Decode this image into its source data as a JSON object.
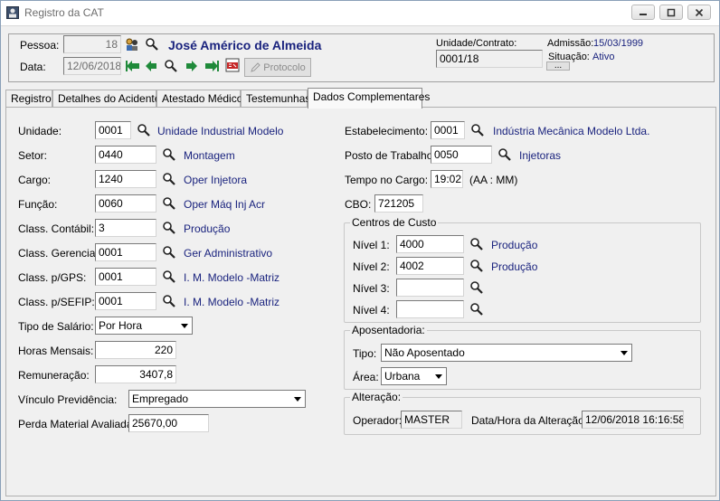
{
  "window": {
    "title": "Registro da CAT"
  },
  "header": {
    "pessoa_label": "Pessoa:",
    "pessoa_code": "18",
    "person_name": "José Américo de Almeida",
    "data_label": "Data:",
    "data_value": "12/06/2018",
    "protocolo_label": "Protocolo",
    "unidade_contrato_label": "Unidade/Contrato:",
    "unidade_contrato_value": "0001/18",
    "admissao_label": "Admissão:",
    "admissao_value": "15/03/1999",
    "situacao_label": "Situação:",
    "situacao_value": "Ativo",
    "dots_label": "..."
  },
  "tabs": [
    {
      "label": "Registro"
    },
    {
      "label": "Detalhes do Acidente"
    },
    {
      "label": "Atestado Médico"
    },
    {
      "label": "Testemunhas"
    },
    {
      "label": "Dados Complementares"
    }
  ],
  "left": {
    "unidade": {
      "label": "Unidade:",
      "code": "0001",
      "desc": "Unidade Industrial Modelo"
    },
    "setor": {
      "label": "Setor:",
      "code": "0440",
      "desc": "Montagem"
    },
    "cargo": {
      "label": "Cargo:",
      "code": "1240",
      "desc": "Oper Injetora"
    },
    "funcao": {
      "label": "Função:",
      "code": "0060",
      "desc": "Oper Máq Inj Acr"
    },
    "class_contabil": {
      "label": "Class. Contábil:",
      "code": "3",
      "desc": "Produção"
    },
    "class_gerencial": {
      "label": "Class. Gerencial:",
      "code": "0001",
      "desc": "Ger Administrativo"
    },
    "class_gps": {
      "label": "Class. p/GPS:",
      "code": "0001",
      "desc": "I. M. Modelo -Matriz"
    },
    "class_sefip": {
      "label": "Class. p/SEFIP:",
      "code": "0001",
      "desc": "I. M. Modelo -Matriz"
    },
    "tipo_salario": {
      "label": "Tipo de Salário:",
      "value": "Por Hora"
    },
    "horas_mensais": {
      "label": "Horas Mensais:",
      "value": "220"
    },
    "remuneracao": {
      "label": "Remuneração:",
      "value": "3407,8"
    },
    "vinculo": {
      "label": "Vínculo Previdência:",
      "value": "Empregado"
    },
    "perda_material": {
      "label": "Perda Material Avaliada:",
      "value": "25670,00"
    }
  },
  "right": {
    "estabelecimento": {
      "label": "Estabelecimento:",
      "code": "0001",
      "desc": "Indústria Mecânica Modelo Ltda."
    },
    "posto_trabalho": {
      "label": "Posto de Trabalho:",
      "code": "0050",
      "desc": "Injetoras"
    },
    "tempo_cargo": {
      "label": "Tempo no Cargo:",
      "value": "19:02",
      "unit": "(AA : MM)"
    },
    "cbo": {
      "label": "CBO:",
      "value": "721205"
    },
    "centros_custo": {
      "title": "Centros de Custo",
      "nivel1": {
        "label": "Nível 1:",
        "code": "4000",
        "desc": "Produção"
      },
      "nivel2": {
        "label": "Nível 2:",
        "code": "4002",
        "desc": "Produção"
      },
      "nivel3": {
        "label": "Nível 3:",
        "code": "",
        "desc": ""
      },
      "nivel4": {
        "label": "Nível 4:",
        "code": "",
        "desc": ""
      }
    },
    "aposentadoria": {
      "title": "Aposentadoria:",
      "tipo_label": "Tipo:",
      "tipo_value": "Não Aposentado",
      "area_label": "Área:",
      "area_value": "Urbana"
    },
    "alteracao": {
      "title": "Alteração:",
      "operador_label": "Operador:",
      "operador_value": "MASTER",
      "datahora_label": "Data/Hora da Alteração:",
      "datahora_value": "12/06/2018 16:16:58"
    }
  },
  "colors": {
    "link_blue": "#1a237e",
    "nav_arrow_green": "#1f8a3a"
  }
}
